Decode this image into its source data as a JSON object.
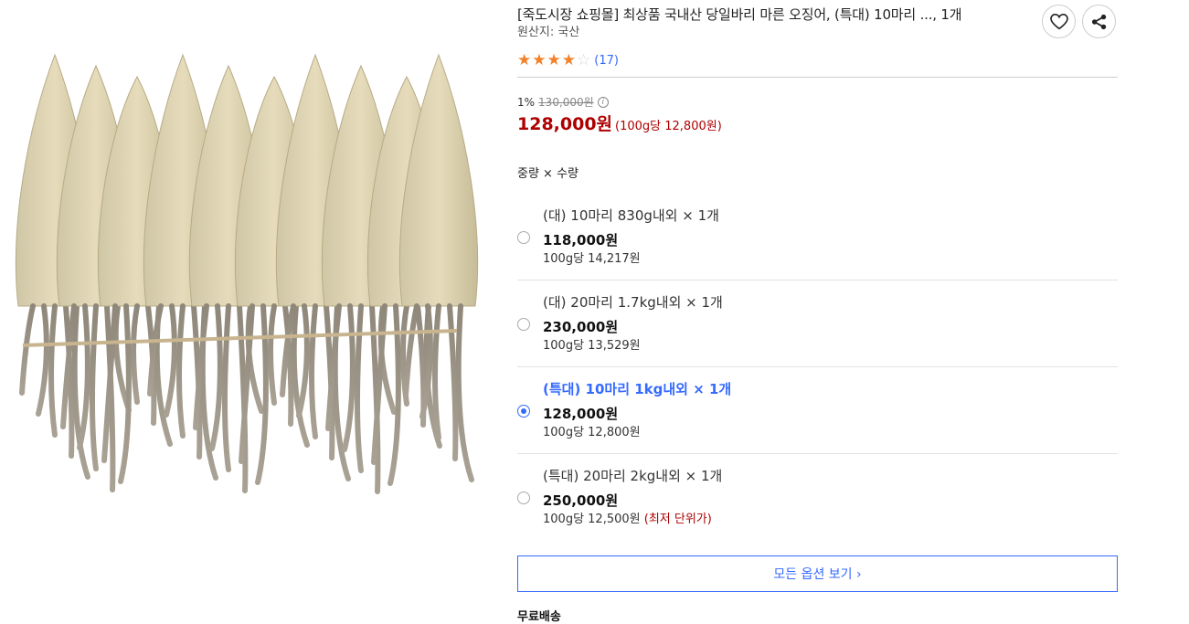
{
  "product": {
    "image_alt": "dried squid product photo",
    "title": "[죽도시장 쇼핑몰] 최상품 국내산 당일바리 마른 오징어, (특대) 10마리 ..., 1개",
    "origin": "원산지: 국산",
    "rating": {
      "stars": 4,
      "max_stars": 5,
      "review_count": "(17)"
    },
    "icons": {
      "heart": "heart-icon",
      "share": "share-icon"
    }
  },
  "price": {
    "discount": "1%",
    "original": "130,000원",
    "sale": "128,000원",
    "unit": "(100g당 12,800원)"
  },
  "options": {
    "label": "중량 × 수량",
    "items": [
      {
        "name": "(대) 10마리 830g내외 × 1개",
        "price": "118,000원",
        "unit": "100g당 14,217원",
        "note": "",
        "selected": false
      },
      {
        "name": "(대) 20마리 1.7kg내외 × 1개",
        "price": "230,000원",
        "unit": "100g당 13,529원",
        "note": "",
        "selected": false
      },
      {
        "name": "(특대) 10마리 1kg내외 × 1개",
        "price": "128,000원",
        "unit": "100g당 12,800원",
        "note": "",
        "selected": true
      },
      {
        "name": "(특대) 20마리 2kg내외 × 1개",
        "price": "250,000원",
        "unit": "100g당 12,500원",
        "note": "(최저 단위가)",
        "selected": false
      }
    ],
    "view_all": "모든 옵션 보기 ›"
  },
  "shipping": {
    "label": "무료배송"
  },
  "colors": {
    "accent": "#346aff",
    "price_red": "#ae0000",
    "star": "#f2812b"
  }
}
